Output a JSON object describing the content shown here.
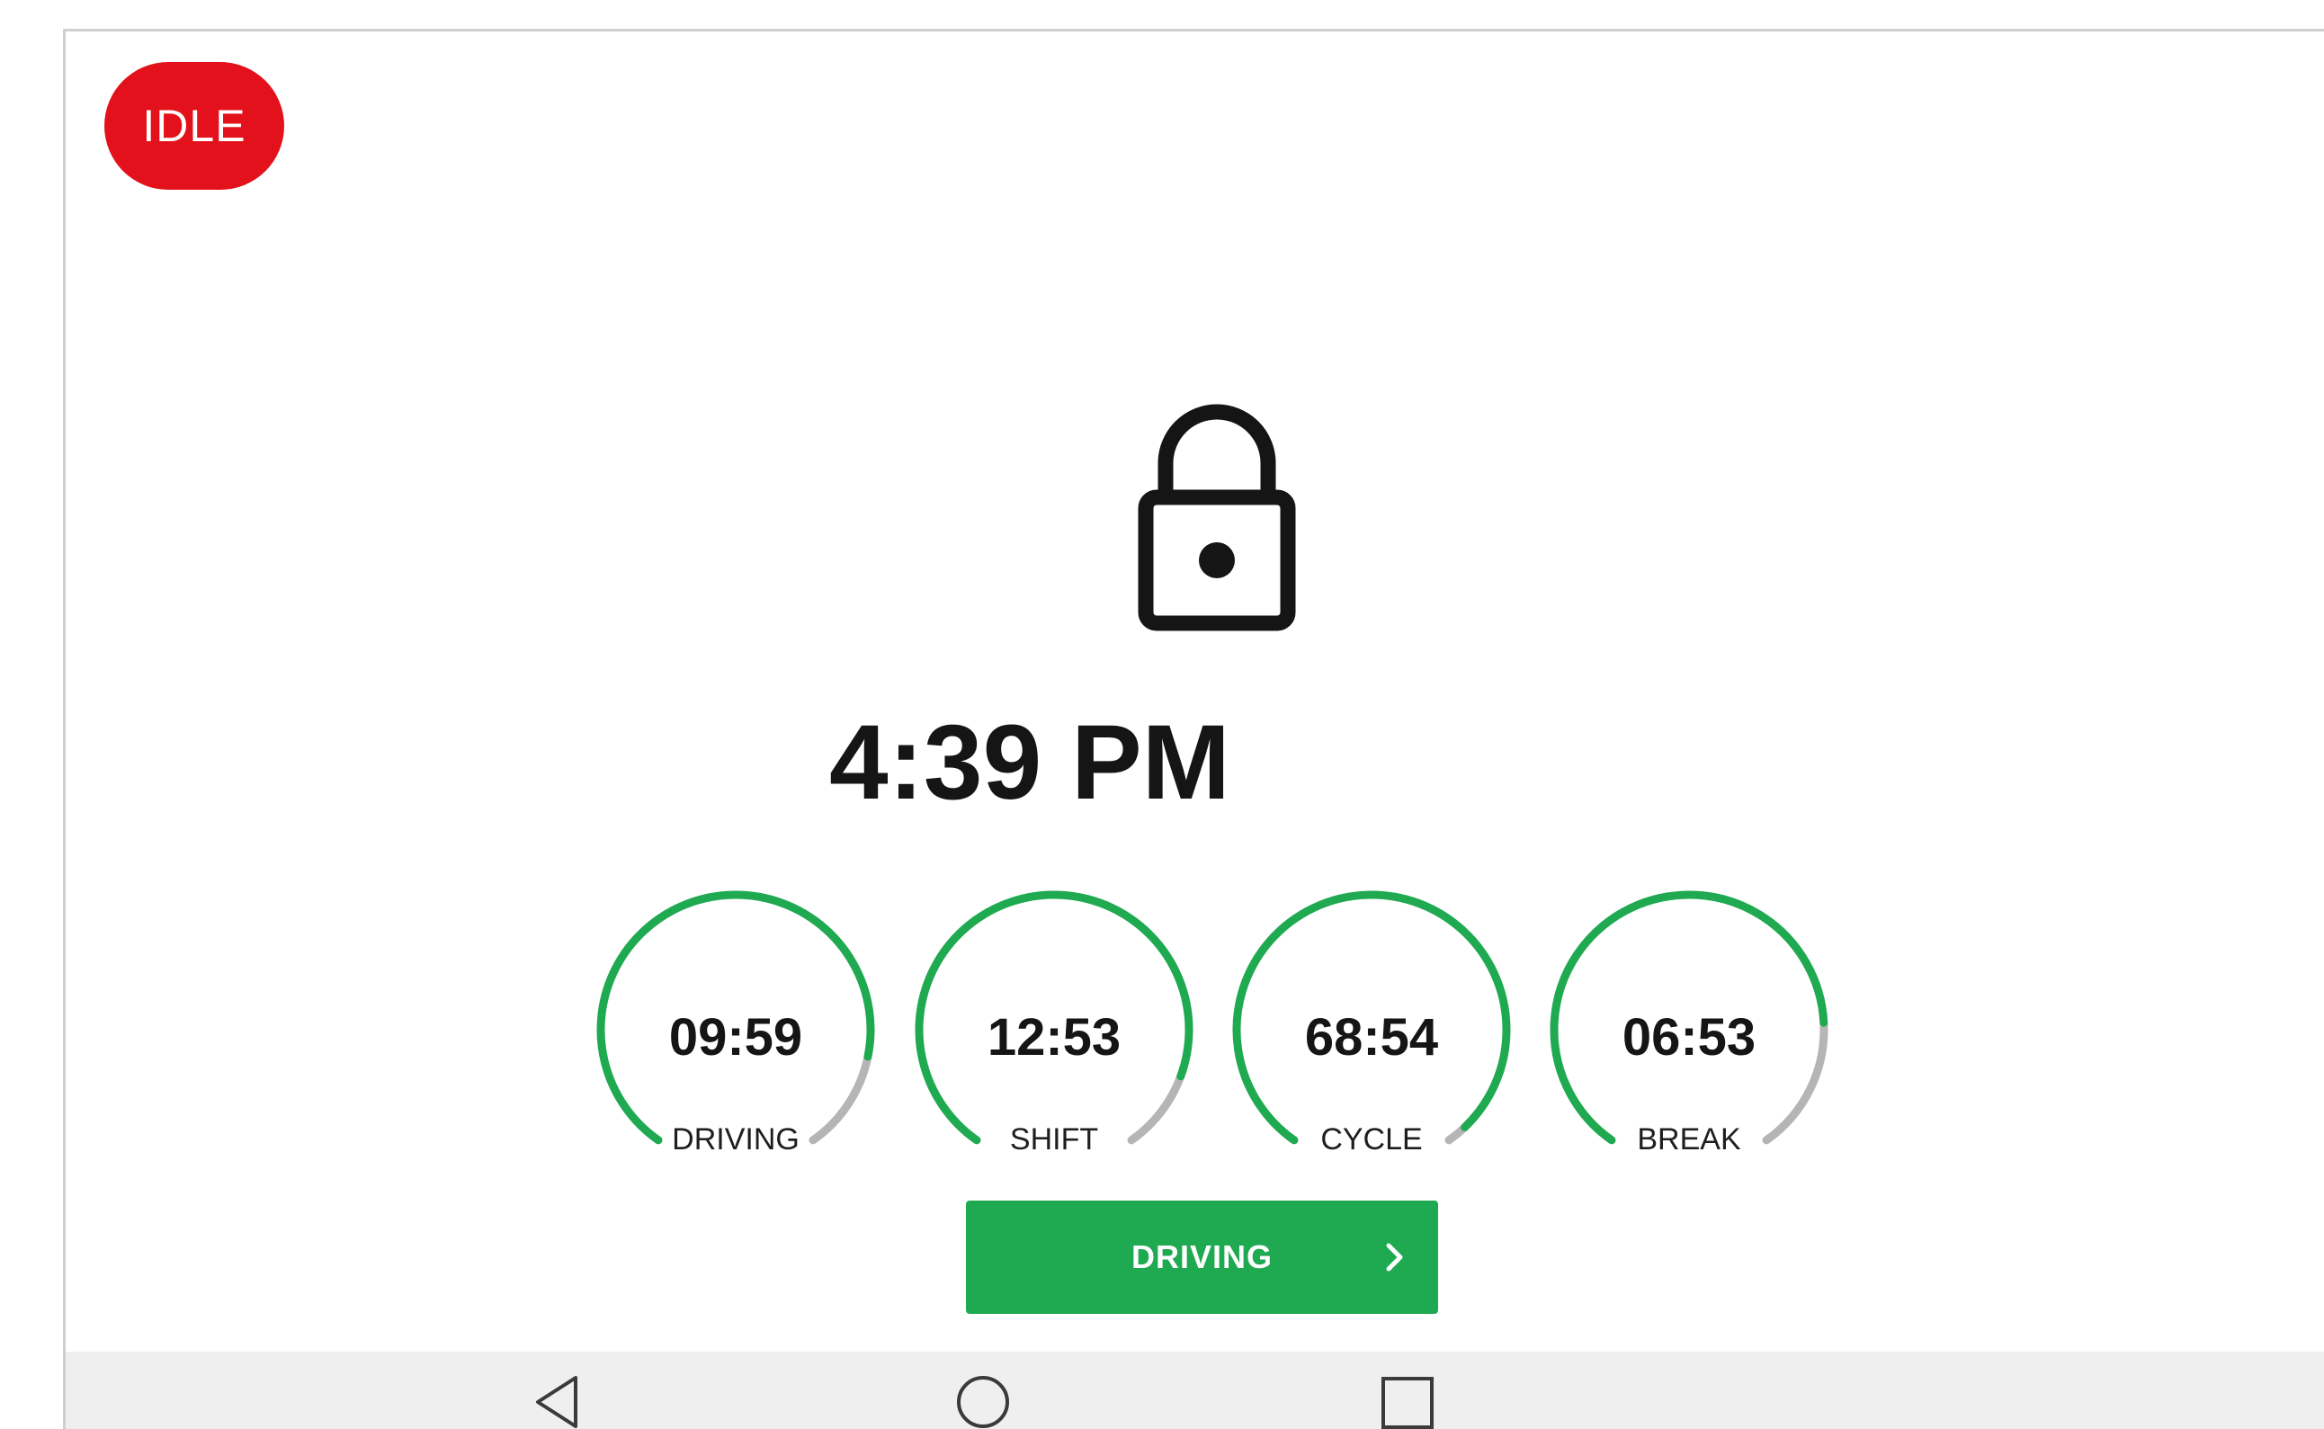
{
  "status_badge": {
    "label": "IDLE",
    "color": "#e3111b"
  },
  "lock": {
    "icon": "lock-icon"
  },
  "clock": {
    "time": "4:39 PM"
  },
  "timers": [
    {
      "value": "09:59",
      "label": "DRIVING",
      "remaining_fraction": 0.85
    },
    {
      "value": "12:53",
      "label": "SHIFT",
      "remaining_fraction": 0.88
    },
    {
      "value": "68:54",
      "label": "CYCLE",
      "remaining_fraction": 0.97
    },
    {
      "value": "06:53",
      "label": "BREAK",
      "remaining_fraction": 0.8
    }
  ],
  "action_button": {
    "label": "DRIVING",
    "icon": "chevron-right-icon",
    "color": "#1fa950"
  },
  "navigation": {
    "back_icon": "back-triangle-icon",
    "home_icon": "home-circle-icon",
    "recents_icon": "recents-square-icon"
  },
  "colors": {
    "accent": "#1fa950",
    "track": "#b5b5b5"
  }
}
